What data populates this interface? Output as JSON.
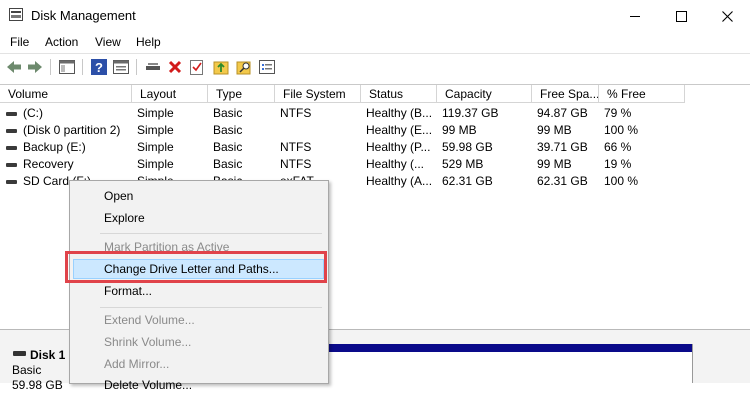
{
  "window": {
    "title": "Disk Management",
    "min_glyph": "—",
    "max_glyph": "☐",
    "close_glyph": "✕"
  },
  "menu": [
    "File",
    "Action",
    "View",
    "Help"
  ],
  "toolbar_icons": [
    "back-icon",
    "forward-icon",
    "properties-icon",
    "help-icon",
    "console-tree-icon",
    "connect-disk-icon",
    "delete-icon",
    "check-icon",
    "folder-up-icon",
    "search-disk-icon",
    "list-icon"
  ],
  "table": {
    "headers": [
      "Volume",
      "Layout",
      "Type",
      "File System",
      "Status",
      "Capacity",
      "Free Spa...",
      "% Free"
    ],
    "rows": [
      [
        "(C:)",
        "Simple",
        "Basic",
        "NTFS",
        "Healthy (B...",
        "119.37 GB",
        "94.87 GB",
        "79 %"
      ],
      [
        "(Disk 0 partition 2)",
        "Simple",
        "Basic",
        "",
        "Healthy (E...",
        "99 MB",
        "99 MB",
        "100 %"
      ],
      [
        "Backup (E:)",
        "Simple",
        "Basic",
        "NTFS",
        "Healthy (P...",
        "59.98 GB",
        "39.71 GB",
        "66 %"
      ],
      [
        "Recovery",
        "Simple",
        "Basic",
        "NTFS",
        "Healthy (...",
        "529 MB",
        "99 MB",
        "19 %"
      ],
      [
        "SD Card (F:)",
        "Simple",
        "Basic",
        "exFAT",
        "Healthy (A...",
        "62.31 GB",
        "62.31 GB",
        "100 %"
      ]
    ]
  },
  "disk_panel": {
    "name": "Disk 1",
    "type": "Basic",
    "size": "59.98 GB"
  },
  "context_menu": {
    "items": [
      {
        "label": "Open",
        "enabled": true
      },
      {
        "label": "Explore",
        "enabled": true
      },
      {
        "label": "Mark Partition as Active",
        "enabled": false
      },
      {
        "label": "Change Drive Letter and Paths...",
        "enabled": true,
        "highlighted": true
      },
      {
        "label": "Format...",
        "enabled": true
      },
      {
        "label": "Extend Volume...",
        "enabled": false
      },
      {
        "label": "Shrink Volume...",
        "enabled": false
      },
      {
        "label": "Add Mirror...",
        "enabled": false
      },
      {
        "label": "Delete Volume...",
        "enabled": true
      }
    ]
  },
  "colors": {
    "highlight": "#cce8ff",
    "highlight_border": "#99d1ff",
    "callout": "#e0434a",
    "disk_bar": "#0a0a8a"
  }
}
